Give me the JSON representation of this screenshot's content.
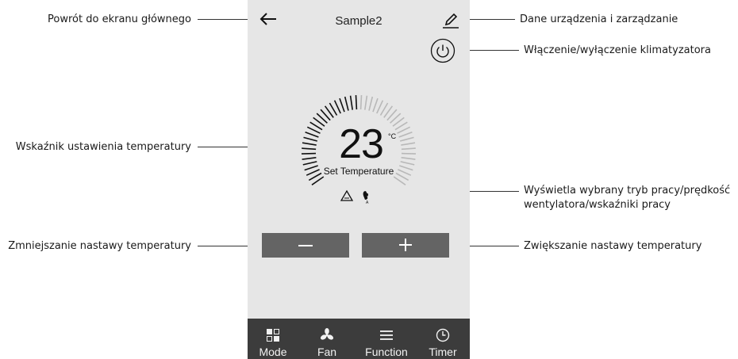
{
  "app": {
    "title": "Sample2",
    "temperature": "23",
    "unit": "°C",
    "set_temperature_label": "Set Temperature",
    "minus_label": "—",
    "plus_label": "+",
    "accent_color": "#646464",
    "nav_bar_color": "#3c3c3c",
    "icons": {
      "back": "arrow-left-icon",
      "edit": "pencil-icon",
      "power": "power-icon",
      "mode_auto": "triangle-recycle-icon",
      "fan_auto": "fan-auto-icon"
    },
    "nav": [
      {
        "label": "Mode",
        "icon": "mode-icon"
      },
      {
        "label": "Fan",
        "icon": "fan-icon"
      },
      {
        "label": "Function",
        "icon": "menu-icon"
      },
      {
        "label": "Timer",
        "icon": "clock-icon"
      }
    ]
  },
  "annotations": {
    "back": "Powrót do ekranu głównego",
    "device": "Dane urządzenia i zarządzanie",
    "power": "Włączenie/wyłączenie klimatyzatora",
    "temp_indicator": "Wskaźnik ustawienia temperatury",
    "mode_display_line1": "Wyświetla wybrany tryb pracy/prędkość",
    "mode_display_line2": "wentylatora/wskaźniki pracy",
    "decrease": "Zmniejszanie nastawy temperatury",
    "increase": "Zwiększanie nastawy temperatury"
  }
}
